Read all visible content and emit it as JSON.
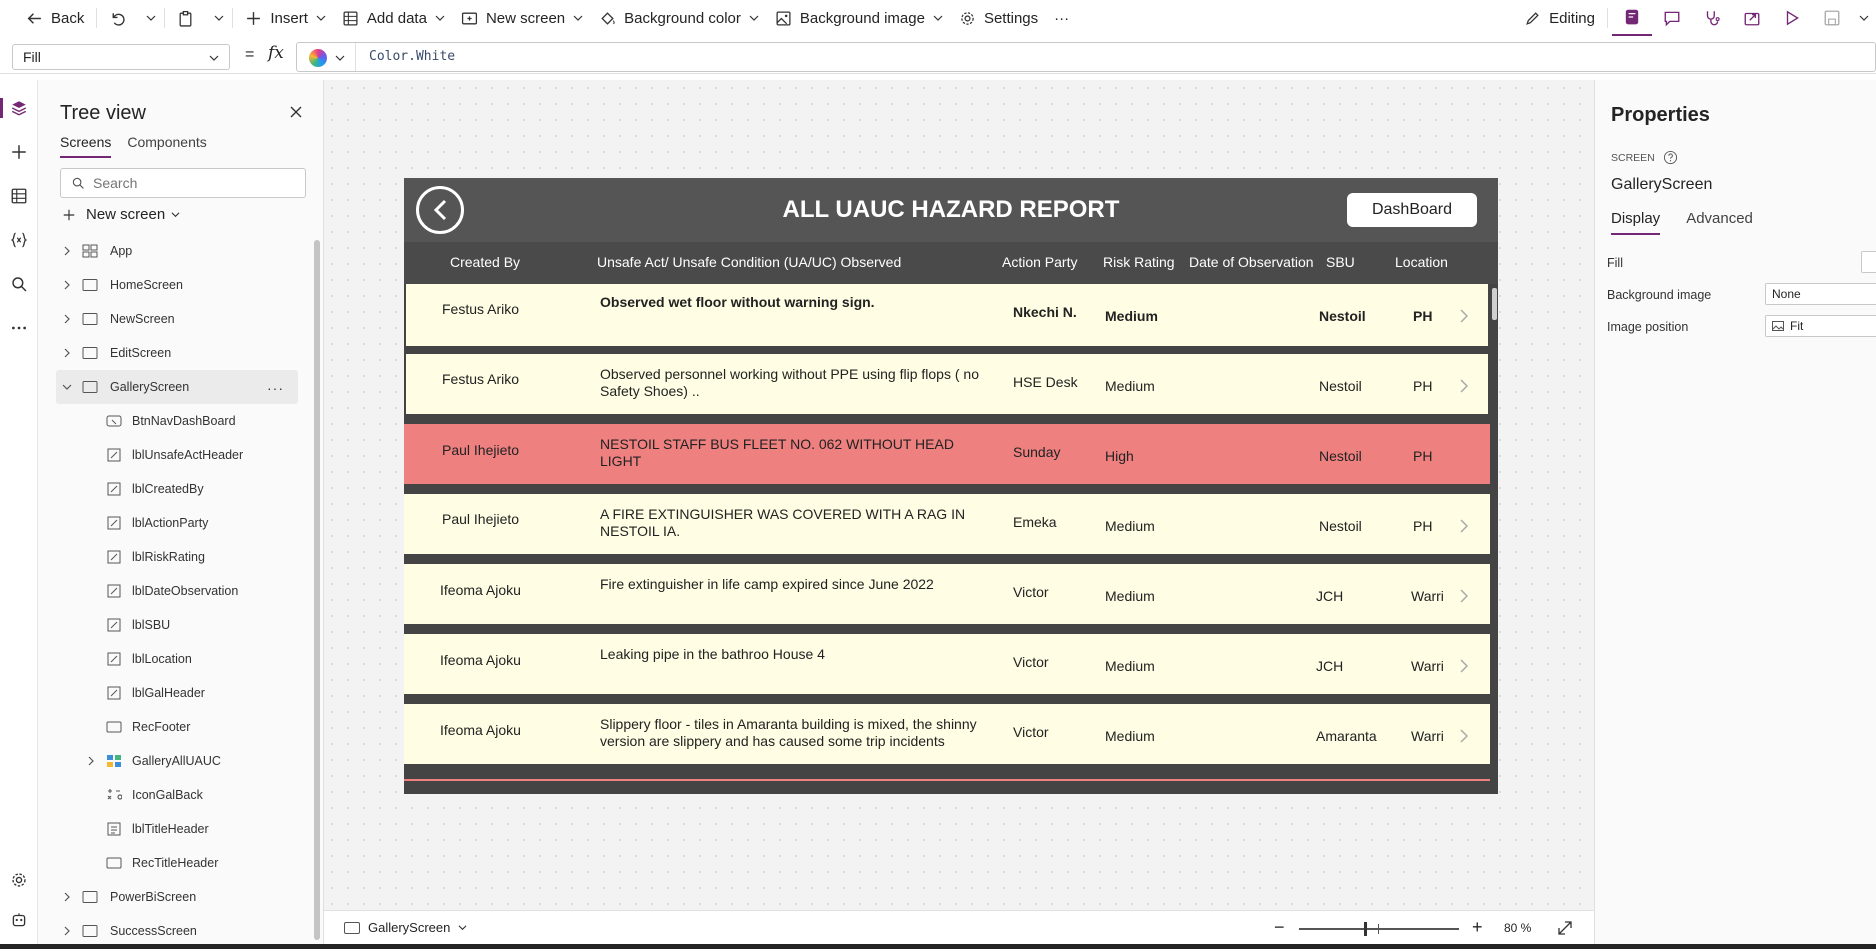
{
  "toolbar": {
    "back": "Back",
    "insert": "Insert",
    "add_data": "Add data",
    "new_screen": "New screen",
    "background_color": "Background color",
    "background_image": "Background image",
    "settings": "Settings",
    "more": "···",
    "editing": "Editing"
  },
  "formula": {
    "property": "Fill",
    "equals": "=",
    "fx": "fx",
    "value": "Color.White"
  },
  "tree": {
    "title": "Tree view",
    "tabs": [
      "Screens",
      "Components"
    ],
    "search_placeholder": "Search",
    "new_screen": "New screen",
    "items": [
      {
        "label": "App",
        "icon": "app-icon"
      },
      {
        "label": "HomeScreen",
        "icon": "screen-icon"
      },
      {
        "label": "NewScreen",
        "icon": "screen-icon"
      },
      {
        "label": "EditScreen",
        "icon": "screen-icon"
      },
      {
        "label": "GalleryScreen",
        "icon": "screen-icon"
      },
      {
        "label": "BtnNavDashBoard",
        "icon": "button-icon"
      },
      {
        "label": "lblUnsafeActHeader",
        "icon": "label-icon"
      },
      {
        "label": "lblCreatedBy",
        "icon": "label-icon"
      },
      {
        "label": "lblActionParty",
        "icon": "label-icon"
      },
      {
        "label": "lblRiskRating",
        "icon": "label-icon"
      },
      {
        "label": "lblDateObservation",
        "icon": "label-icon"
      },
      {
        "label": "lblSBU",
        "icon": "label-icon"
      },
      {
        "label": "lblLocation",
        "icon": "label-icon"
      },
      {
        "label": "lblGalHeader",
        "icon": "label-icon"
      },
      {
        "label": "RecFooter",
        "icon": "rectangle-icon"
      },
      {
        "label": "GalleryAllUAUC",
        "icon": "gallery-icon"
      },
      {
        "label": "IconGalBack",
        "icon": "icon-control-icon"
      },
      {
        "label": "lblTitleHeader",
        "icon": "text-icon"
      },
      {
        "label": "RecTitleHeader",
        "icon": "rectangle-icon"
      },
      {
        "label": "PowerBiScreen",
        "icon": "screen-icon"
      },
      {
        "label": "SuccessScreen",
        "icon": "screen-icon"
      }
    ]
  },
  "app": {
    "title": "ALL UAUC HAZARD REPORT",
    "dashboard_button": "DashBoard",
    "columns": {
      "created_by": "Created By",
      "unsafe_act": "Unsafe Act/ Unsafe Condition (UA/UC) Observed",
      "action_party": "Action Party",
      "risk_rating": "Risk Rating",
      "date": "Date of Observation",
      "sbu": "SBU",
      "location": "Location"
    },
    "rows": [
      {
        "created_by": "Festus Ariko",
        "observation": "Observed wet floor without warning sign.",
        "action_party": "Nkechi N.",
        "risk": "Medium",
        "sbu": "Nestoil",
        "location": "PH"
      },
      {
        "created_by": "Festus Ariko",
        "observation": "Observed personnel working without PPE using flip flops ( no Safety Shoes) ..",
        "action_party": "HSE Desk",
        "risk": "Medium",
        "sbu": "Nestoil",
        "location": "PH"
      },
      {
        "created_by": "Paul Ihejieto",
        "observation": "NESTOIL STAFF BUS FLEET NO. 062 WITHOUT HEAD LIGHT",
        "action_party": "Sunday",
        "risk": "High",
        "sbu": "Nestoil",
        "location": "PH"
      },
      {
        "created_by": "Paul Ihejieto",
        "observation": "A FIRE EXTINGUISHER WAS COVERED WITH A RAG IN NESTOIL IA.",
        "action_party": "Emeka",
        "risk": "Medium",
        "sbu": "Nestoil",
        "location": "PH"
      },
      {
        "created_by": "Ifeoma Ajoku",
        "observation": "Fire extinguisher in life camp expired since  June 2022",
        "action_party": "Victor",
        "risk": "Medium",
        "sbu": "JCH",
        "location": "Warri"
      },
      {
        "created_by": "Ifeoma Ajoku",
        "observation": "Leaking pipe in the bathroo House 4",
        "action_party": "Victor",
        "risk": "Medium",
        "sbu": "JCH",
        "location": "Warri"
      },
      {
        "created_by": "Ifeoma Ajoku",
        "observation": "Slippery floor - tiles in Amaranta building is mixed, the shinny version are slippery and has caused some trip incidents",
        "action_party": "Victor",
        "risk": "Medium",
        "sbu": "Amaranta",
        "location": "Warri"
      }
    ],
    "colors": {
      "row": "#fffde3",
      "high_row": "#ef8080",
      "header": "#555555"
    }
  },
  "canvas": {
    "screen_selector": "GalleryScreen",
    "zoom_minus": "−",
    "zoom_plus": "+",
    "zoom": "80 %"
  },
  "properties": {
    "title": "Properties",
    "type": "SCREEN",
    "name": "GalleryScreen",
    "tabs": [
      "Display",
      "Advanced"
    ],
    "fill_label": "Fill",
    "bg_image_label": "Background image",
    "bg_image_value": "None",
    "image_position_label": "Image position",
    "image_position_value": "Fit"
  },
  "accent": "#742774"
}
